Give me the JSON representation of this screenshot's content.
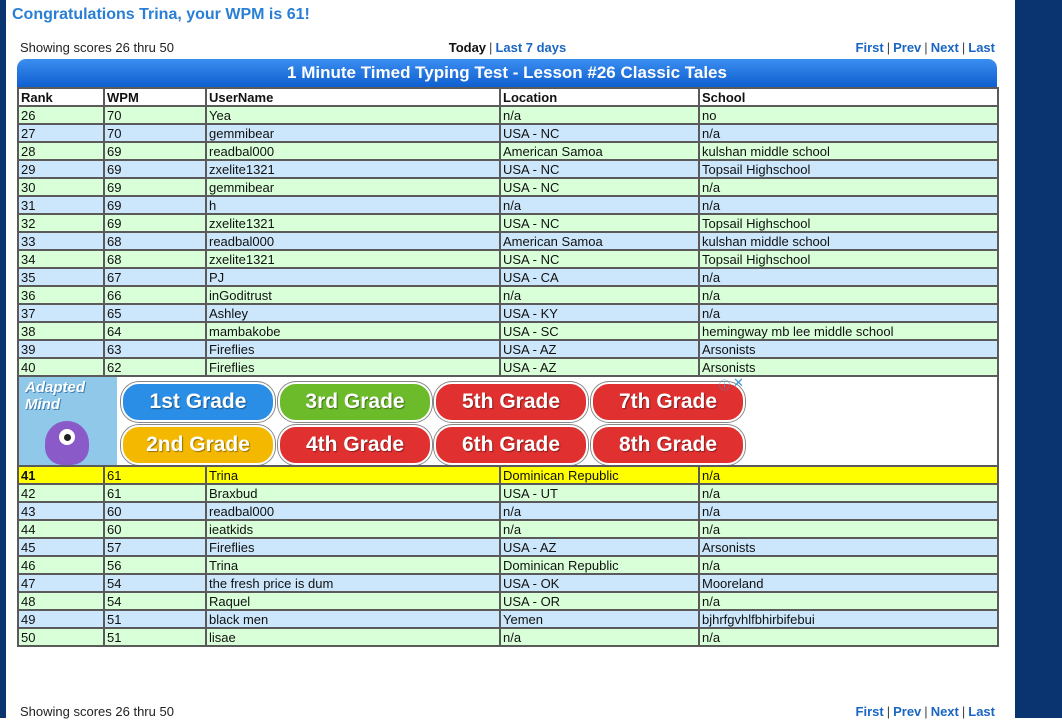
{
  "congrats": "Congratulations Trina, your WPM is 61!",
  "nav_top": {
    "showing": "Showing scores 26 thru 50",
    "today": "Today",
    "sep": "|",
    "last7": "Last 7 days",
    "first": "First",
    "prev": "Prev",
    "next": "Next",
    "last": "Last"
  },
  "nav_bottom": {
    "showing": "Showing scores 26 thru 50",
    "first": "First",
    "prev": "Prev",
    "next": "Next",
    "last": "Last"
  },
  "table": {
    "title": "1 Minute Timed Typing Test - Lesson #26 Classic Tales",
    "headers": [
      "Rank",
      "WPM",
      "UserName",
      "Location",
      "School"
    ],
    "rows_a": [
      [
        "26",
        "70",
        "Yea",
        "n/a",
        "no"
      ],
      [
        "27",
        "70",
        "gemmibear",
        "USA - NC",
        "n/a"
      ],
      [
        "28",
        "69",
        "readbal000",
        "American Samoa",
        "kulshan middle school"
      ],
      [
        "29",
        "69",
        "zxelite1321",
        "USA - NC",
        "Topsail Highschool"
      ],
      [
        "30",
        "69",
        "gemmibear",
        "USA - NC",
        "n/a"
      ],
      [
        "31",
        "69",
        "h",
        "n/a",
        "n/a"
      ],
      [
        "32",
        "69",
        "zxelite1321",
        "USA - NC",
        "Topsail Highschool"
      ],
      [
        "33",
        "68",
        "readbal000",
        "American Samoa",
        "kulshan middle school"
      ],
      [
        "34",
        "68",
        "zxelite1321",
        "USA - NC",
        "Topsail Highschool"
      ],
      [
        "35",
        "67",
        "PJ",
        "USA - CA",
        "n/a"
      ],
      [
        "36",
        "66",
        "inGoditrust",
        "n/a",
        "n/a"
      ],
      [
        "37",
        "65",
        "Ashley",
        "USA - KY",
        "n/a"
      ],
      [
        "38",
        "64",
        "mambakobe",
        "USA - SC",
        "hemingway mb lee middle school"
      ],
      [
        "39",
        "63",
        "Fireflies",
        "USA - AZ",
        "Arsonists"
      ],
      [
        "40",
        "62",
        "Fireflies",
        "USA - AZ",
        "Arsonists"
      ]
    ],
    "rows_b": [
      [
        "41",
        "61",
        "Trina",
        "Dominican Republic",
        "n/a"
      ],
      [
        "42",
        "61",
        "Braxbud",
        "USA - UT",
        "n/a"
      ],
      [
        "43",
        "60",
        "readbal000",
        "n/a",
        "n/a"
      ],
      [
        "44",
        "60",
        "ieatkids",
        "n/a",
        "n/a"
      ],
      [
        "45",
        "57",
        "Fireflies",
        "USA - AZ",
        "Arsonists"
      ],
      [
        "46",
        "56",
        "Trina",
        "Dominican Republic",
        "n/a"
      ],
      [
        "47",
        "54",
        "the fresh price is dum",
        "USA - OK",
        "Mooreland"
      ],
      [
        "48",
        "54",
        "Raquel",
        "USA - OR",
        "n/a"
      ],
      [
        "49",
        "51",
        "black men",
        "Yemen",
        "bjhrfgvhlfbhirbifebui"
      ],
      [
        "50",
        "51",
        "lisae",
        "n/a",
        "n/a"
      ]
    ],
    "highlight_rank": "41"
  },
  "ad": {
    "brand_line1": "Adapted",
    "brand_line2": "Mind",
    "info": "ⓘ",
    "close": "✕",
    "grades": [
      {
        "label": "1st Grade",
        "color": "#2a8ee6"
      },
      {
        "label": "3rd Grade",
        "color": "#6cbb2a"
      },
      {
        "label": "5th Grade",
        "color": "#e03030"
      },
      {
        "label": "7th Grade",
        "color": "#e03030"
      },
      {
        "label": "2nd Grade",
        "color": "#f5b800"
      },
      {
        "label": "4th Grade",
        "color": "#e03030"
      },
      {
        "label": "6th Grade",
        "color": "#e03030"
      },
      {
        "label": "8th Grade",
        "color": "#e03030"
      }
    ]
  },
  "colors": {
    "row_green": "#d8ffd8",
    "row_blue": "#cce6fb",
    "row_highlight": "#ffff00",
    "header_blue": "#1f6fd8",
    "sidebar": "#0a3470"
  }
}
